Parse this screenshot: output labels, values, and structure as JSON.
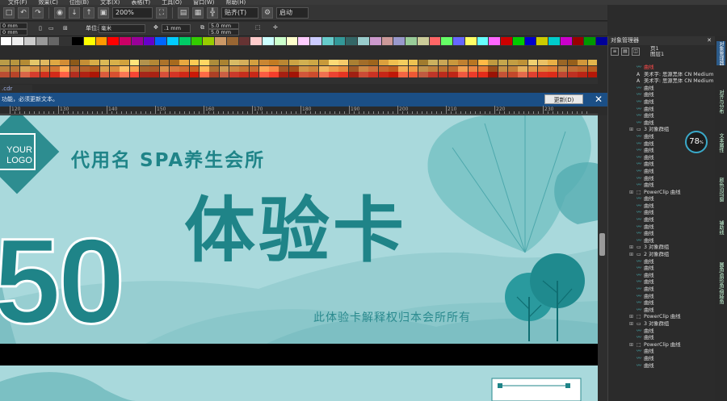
{
  "menubar": {
    "items": [
      "文件(F)",
      "效果(C)",
      "位图(B)",
      "文本(X)",
      "表格(T)",
      "工具(O)",
      "窗口(W)",
      "帮助(H)"
    ]
  },
  "toolbar": {
    "zoom": "200%",
    "snap": "贴齐(T)",
    "launch": "启动"
  },
  "property_bar": {
    "x": "0 mm",
    "y": "0 mm",
    "unit_label": "单位:",
    "unit": "毫米",
    "nudge": ".1 mm",
    "dup_x": "5.0 mm",
    "dup_y": "5.0 mm"
  },
  "document": {
    "tab": ".cdr"
  },
  "notice": {
    "text": "功能，必须更新文本。",
    "update_button": "更新(D)"
  },
  "ruler": {
    "labels": [
      "120",
      "130",
      "140",
      "150",
      "160",
      "170",
      "180",
      "190",
      "200",
      "210",
      "220",
      "230"
    ]
  },
  "card": {
    "logo": "YOUR LOGO",
    "brand": "代用名 SPA养生会所",
    "title": "体验卡",
    "value": "50",
    "footnote": "此体验卡解释权归本会所所有"
  },
  "docker": {
    "title": "对象管理器",
    "page": "页1",
    "layer": "图层1",
    "tree": [
      {
        "label": "曲线",
        "type": "curve",
        "selected": true
      },
      {
        "label": "美术字: 思源黑体 CN Medium",
        "type": "text"
      },
      {
        "label": "美术字: 思源黑体 CN Medium",
        "type": "text"
      },
      {
        "label": "曲线",
        "type": "curve"
      },
      {
        "label": "曲线",
        "type": "curve"
      },
      {
        "label": "曲线",
        "type": "curve"
      },
      {
        "label": "曲线",
        "type": "curve"
      },
      {
        "label": "曲线",
        "type": "curve"
      },
      {
        "label": "曲线",
        "type": "curve"
      },
      {
        "label": "3 对象群组",
        "type": "group",
        "expandable": true
      },
      {
        "label": "曲线",
        "type": "curve"
      },
      {
        "label": "曲线",
        "type": "curve"
      },
      {
        "label": "曲线",
        "type": "curve"
      },
      {
        "label": "曲线",
        "type": "curve"
      },
      {
        "label": "曲线",
        "type": "curve"
      },
      {
        "label": "曲线",
        "type": "curve"
      },
      {
        "label": "曲线",
        "type": "curve"
      },
      {
        "label": "曲线",
        "type": "curve"
      },
      {
        "label": "PowerClip 曲线",
        "type": "powerclip",
        "expandable": true
      },
      {
        "label": "曲线",
        "type": "curve"
      },
      {
        "label": "曲线",
        "type": "curve"
      },
      {
        "label": "曲线",
        "type": "curve"
      },
      {
        "label": "曲线",
        "type": "curve"
      },
      {
        "label": "曲线",
        "type": "curve"
      },
      {
        "label": "曲线",
        "type": "curve"
      },
      {
        "label": "曲线",
        "type": "curve"
      },
      {
        "label": "3 对象群组",
        "type": "group",
        "expandable": true
      },
      {
        "label": "2 对象群组",
        "type": "group",
        "expandable": true
      },
      {
        "label": "曲线",
        "type": "curve"
      },
      {
        "label": "曲线",
        "type": "curve"
      },
      {
        "label": "曲线",
        "type": "curve"
      },
      {
        "label": "曲线",
        "type": "curve"
      },
      {
        "label": "曲线",
        "type": "curve"
      },
      {
        "label": "曲线",
        "type": "curve"
      },
      {
        "label": "曲线",
        "type": "curve"
      },
      {
        "label": "曲线",
        "type": "curve"
      },
      {
        "label": "PowerClip 曲线",
        "type": "powerclip",
        "expandable": true
      },
      {
        "label": "3 对象群组",
        "type": "group",
        "expandable": true
      },
      {
        "label": "曲线",
        "type": "curve"
      },
      {
        "label": "曲线",
        "type": "curve"
      },
      {
        "label": "PowerClip 曲线",
        "type": "powerclip",
        "expandable": true
      },
      {
        "label": "曲线",
        "type": "curve"
      },
      {
        "label": "曲线",
        "type": "curve"
      },
      {
        "label": "曲线",
        "type": "curve"
      }
    ]
  },
  "gauge": {
    "value": "78",
    "unit": "%"
  },
  "side_tabs": [
    "对象管理器",
    "对齐与分布",
    "文本属性",
    "颜色泊坞窗",
    "辅助线",
    "圆角/扇形角/倒棱角"
  ],
  "colors": {
    "accent": "#1f8488",
    "card_bg": "#a9d9dc",
    "notice_bg": "#1b4f86"
  }
}
